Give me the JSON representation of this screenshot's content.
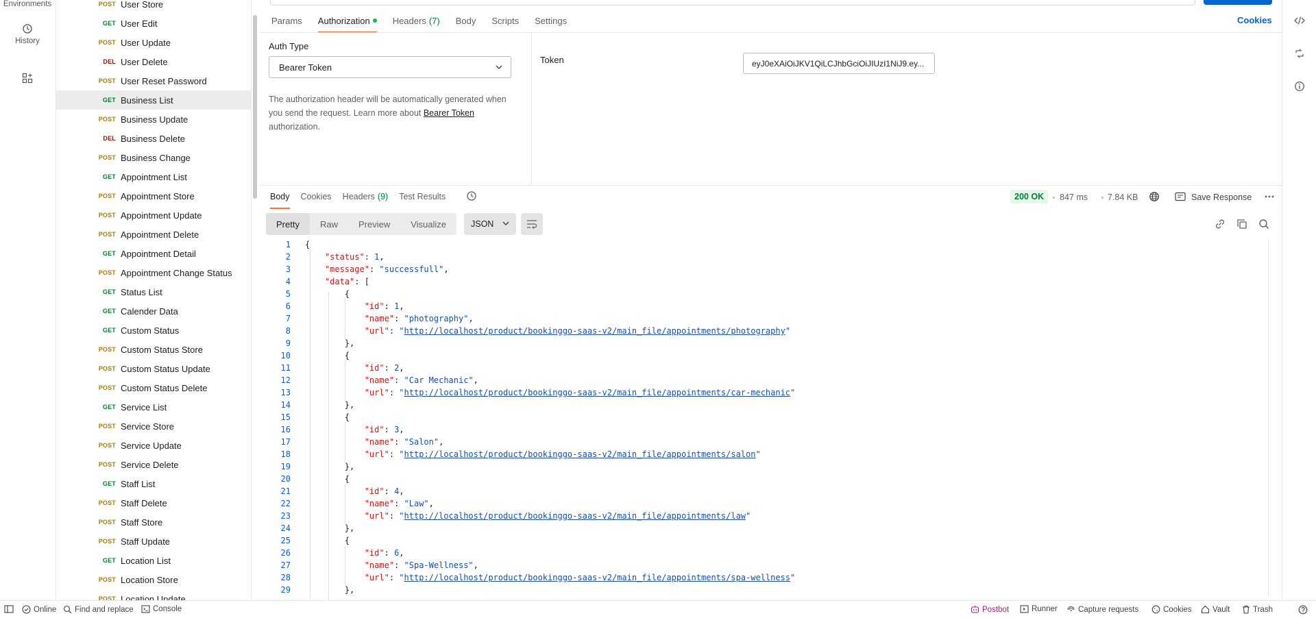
{
  "rail": {
    "environments_label": "Environments",
    "history_label": "History"
  },
  "sidebar": {
    "items": [
      {
        "method": "POST",
        "name": "User Store"
      },
      {
        "method": "GET",
        "name": "User Edit"
      },
      {
        "method": "POST",
        "name": "User Update"
      },
      {
        "method": "DEL",
        "name": "User Delete"
      },
      {
        "method": "POST",
        "name": "User Reset Password"
      },
      {
        "method": "GET",
        "name": "Business List",
        "selected": true
      },
      {
        "method": "POST",
        "name": "Business Update"
      },
      {
        "method": "DEL",
        "name": "Business Delete"
      },
      {
        "method": "POST",
        "name": "Business Change"
      },
      {
        "method": "GET",
        "name": "Appointment List"
      },
      {
        "method": "POST",
        "name": "Appointment Store"
      },
      {
        "method": "POST",
        "name": "Appointment Update"
      },
      {
        "method": "POST",
        "name": "Appointment Delete"
      },
      {
        "method": "GET",
        "name": "Appointment Detail"
      },
      {
        "method": "POST",
        "name": "Appointment Change Status"
      },
      {
        "method": "GET",
        "name": "Status List"
      },
      {
        "method": "GET",
        "name": "Calender Data"
      },
      {
        "method": "GET",
        "name": "Custom Status"
      },
      {
        "method": "POST",
        "name": "Custom Status Store"
      },
      {
        "method": "POST",
        "name": "Custom Status Update"
      },
      {
        "method": "POST",
        "name": "Custom Status Delete"
      },
      {
        "method": "GET",
        "name": "Service List"
      },
      {
        "method": "POST",
        "name": "Service Store"
      },
      {
        "method": "POST",
        "name": "Service Update"
      },
      {
        "method": "POST",
        "name": "Service Delete"
      },
      {
        "method": "GET",
        "name": "Staff List"
      },
      {
        "method": "POST",
        "name": "Staff Delete"
      },
      {
        "method": "POST",
        "name": "Staff Store"
      },
      {
        "method": "POST",
        "name": "Staff Update"
      },
      {
        "method": "GET",
        "name": "Location List"
      },
      {
        "method": "POST",
        "name": "Location Store"
      },
      {
        "method": "POST",
        "name": "Location Update"
      }
    ]
  },
  "request_tabs": {
    "params": "Params",
    "authorization": "Authorization",
    "headers": "Headers",
    "headers_count": "(7)",
    "body": "Body",
    "scripts": "Scripts",
    "settings": "Settings",
    "cookies": "Cookies"
  },
  "auth": {
    "type_label": "Auth Type",
    "type_value": "Bearer Token",
    "desc_before": "The authorization header will be automatically generated when you send the request. Learn more about ",
    "desc_link": "Bearer Token",
    "desc_after": " authorization.",
    "token_label": "Token",
    "token_value": "eyJ0eXAiOiJKV1QiLCJhbGciOiJIUzI1NiJ9.ey..."
  },
  "response_tabs": {
    "body": "Body",
    "cookies": "Cookies",
    "headers": "Headers",
    "headers_count": "(9)",
    "test_results": "Test Results"
  },
  "response_meta": {
    "status": "200 OK",
    "time": "847 ms",
    "size": "7.84 KB",
    "save_response": "Save Response"
  },
  "view_modes": {
    "pretty": "Pretty",
    "raw": "Raw",
    "preview": "Preview",
    "visualize": "Visualize",
    "format": "JSON"
  },
  "code": {
    "status_key": "\"status\"",
    "status_value": "1",
    "message_key": "\"message\"",
    "message_value": "\"successfull\"",
    "data_key": "\"data\"",
    "items": [
      {
        "id": "1",
        "name": "\"photography\"",
        "url": "http://localhost/product/bookinggo-saas-v2/main_file/appointments/photography"
      },
      {
        "id": "2",
        "name": "\"Car Mechanic\"",
        "url": "http://localhost/product/bookinggo-saas-v2/main_file/appointments/car-mechanic"
      },
      {
        "id": "3",
        "name": "\"Salon\"",
        "url": "http://localhost/product/bookinggo-saas-v2/main_file/appointments/salon"
      },
      {
        "id": "4",
        "name": "\"Law\"",
        "url": "http://localhost/product/bookinggo-saas-v2/main_file/appointments/law"
      },
      {
        "id": "6",
        "name": "\"Spa-Wellness\"",
        "url": "http://localhost/product/bookinggo-saas-v2/main_file/appointments/spa-wellness"
      }
    ]
  },
  "statusbar": {
    "online": "Online",
    "find_replace": "Find and replace",
    "console": "Console",
    "postbot": "Postbot",
    "runner": "Runner",
    "capture": "Capture requests",
    "cookies": "Cookies",
    "vault": "Vault",
    "trash": "Trash"
  }
}
